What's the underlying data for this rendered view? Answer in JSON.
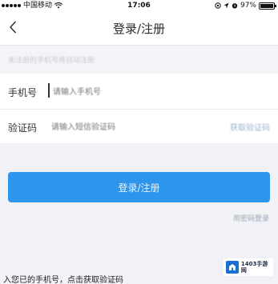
{
  "status_bar": {
    "carrier": "中国移动",
    "time": "17:06",
    "battery_text": "97%",
    "battery_level": 0.97
  },
  "nav": {
    "back_icon": "chevron-left-icon",
    "title": "登录/注册"
  },
  "hint": {
    "text": "未注册的手机号将自动注册"
  },
  "phone_field": {
    "label": "手机号",
    "placeholder": "请输入手机号"
  },
  "code_field": {
    "label": "验证码",
    "placeholder": "请输入短信验证码",
    "get_code_label": "获取验证码"
  },
  "login_button": {
    "label": "登录/注册",
    "color": "#2d96ec"
  },
  "password_link": {
    "label": "用密码登录"
  },
  "watermark": {
    "text": "1403手游网"
  },
  "caption": {
    "text": "入您已的手机号，点击获取验证码"
  }
}
